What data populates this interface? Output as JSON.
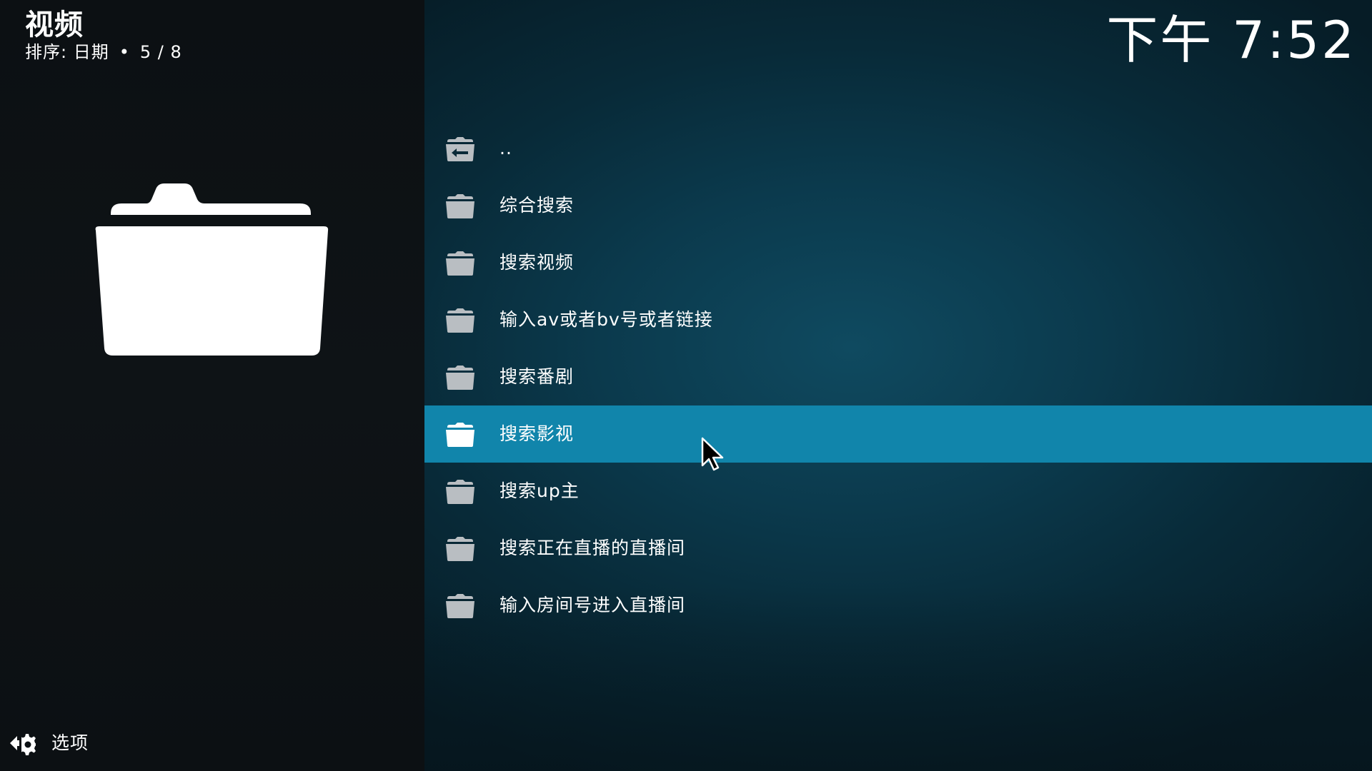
{
  "header": {
    "title": "视频",
    "sort_label": "排序: 日期",
    "separator": "•",
    "position": "5 / 8"
  },
  "clock": {
    "time": "下午 7:52"
  },
  "list": {
    "selected_index": 5,
    "items": [
      {
        "label": "..",
        "icon": "folder-back-icon"
      },
      {
        "label": "综合搜索",
        "icon": "folder-icon"
      },
      {
        "label": "搜索视频",
        "icon": "folder-icon"
      },
      {
        "label": "输入av或者bv号或者链接",
        "icon": "folder-icon"
      },
      {
        "label": "搜索番剧",
        "icon": "folder-icon"
      },
      {
        "label": "搜索影视",
        "icon": "folder-icon"
      },
      {
        "label": "搜索up主",
        "icon": "folder-icon"
      },
      {
        "label": "搜索正在直播的直播间",
        "icon": "folder-icon"
      },
      {
        "label": "输入房间号进入直播间",
        "icon": "folder-icon"
      }
    ]
  },
  "preview": {
    "icon": "folder-open-icon"
  },
  "footer": {
    "options_label": "选项",
    "options_icon": "gear-arrow-icon"
  },
  "colors": {
    "highlight": "#1185ab",
    "left_panel": "#0e1316",
    "right_panel": "#0b3a4d"
  }
}
